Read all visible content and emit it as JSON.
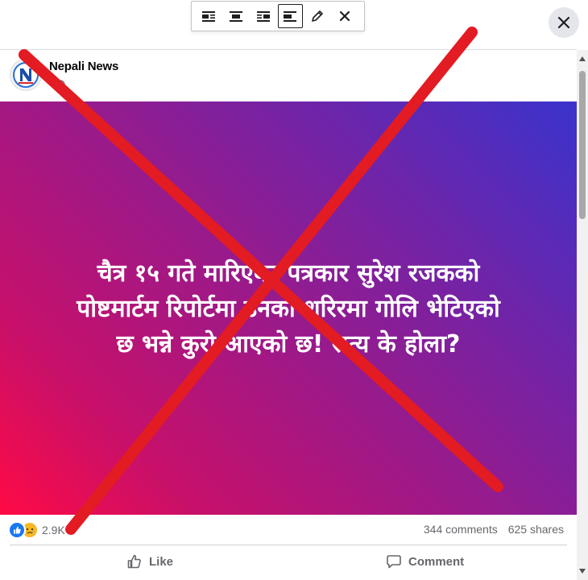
{
  "toolbar": {
    "buttons": [
      {
        "name": "align-left",
        "icon": "align-left-icon",
        "active": false
      },
      {
        "name": "align-center",
        "icon": "align-center-icon",
        "active": false
      },
      {
        "name": "align-right",
        "icon": "align-right-icon",
        "active": false
      },
      {
        "name": "align-none",
        "icon": "align-none-icon",
        "active": true
      },
      {
        "name": "edit",
        "icon": "pencil-icon",
        "active": false
      },
      {
        "name": "remove",
        "icon": "close-icon",
        "active": false
      }
    ]
  },
  "modal": {
    "close_icon": "close-icon"
  },
  "post": {
    "page_name": "Nepali News",
    "privacy_icon": "globe-icon",
    "image": {
      "headline_lines": [
        "चैत्र १५ गते मारिएका पत्रकार सुरेश रजकको",
        "पोष्टमार्टम रिपोर्टमा उनको शरिरमा गोलि भेटिएको",
        "छ भन्ने कुरो आएको छ! सत्य के होला?"
      ],
      "gradient_colors": [
        "#ff0a45",
        "#9a1a8a",
        "#3a33cc"
      ]
    },
    "overlay": {
      "type": "red-x-cross",
      "color": "#e31b23"
    },
    "reactions": {
      "icons": [
        "like-icon",
        "sad-icon"
      ],
      "count": "2.9K"
    },
    "stats": {
      "comments": "344 comments",
      "shares": "625 shares"
    },
    "actions": {
      "like": "Like",
      "comment": "Comment"
    }
  },
  "colors": {
    "accent": "#1877f2",
    "muted_text": "#65676b",
    "divider": "#dadde1"
  }
}
